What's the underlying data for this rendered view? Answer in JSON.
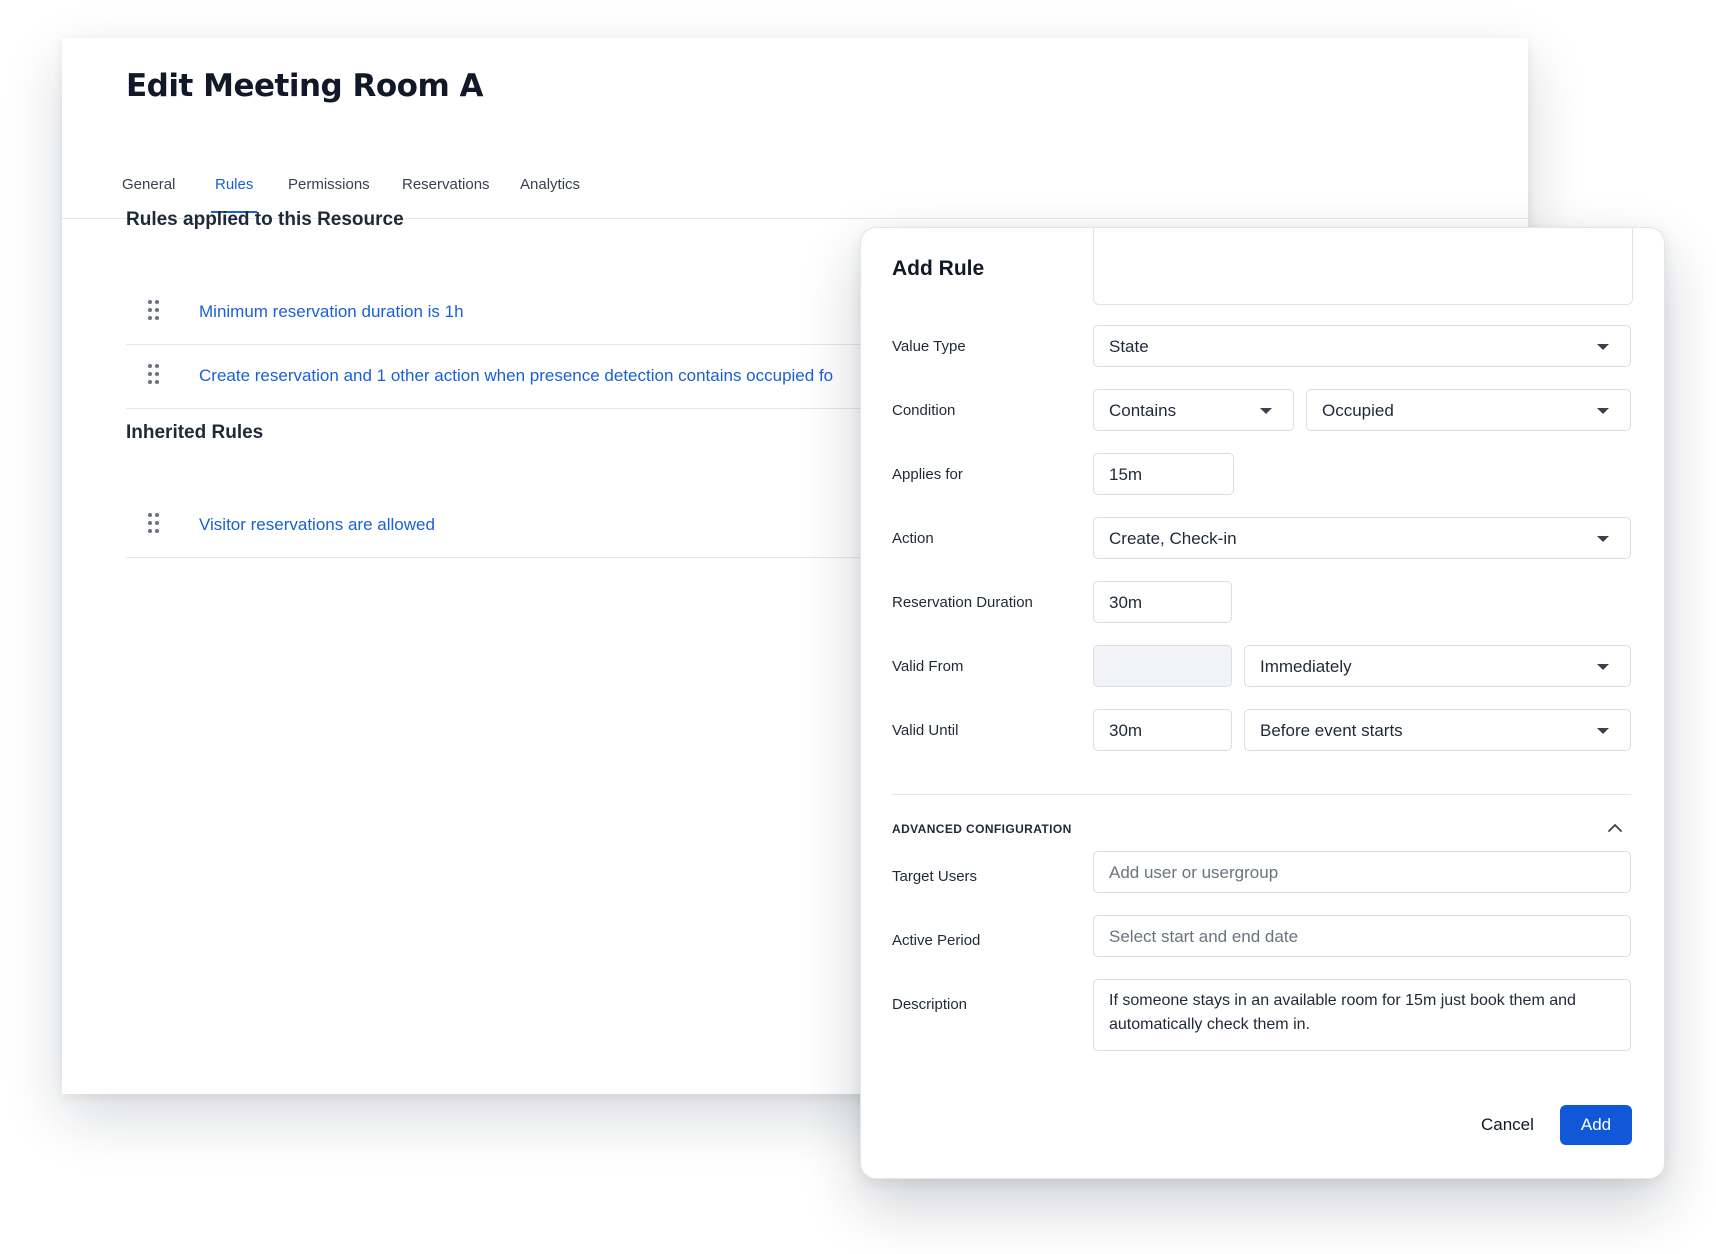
{
  "page": {
    "title": "Edit Meeting Room A",
    "tabs": [
      "General",
      "Rules",
      "Permissions",
      "Reservations",
      "Analytics"
    ],
    "active_tab": "Rules",
    "applied_section_title": "Rules applied to this Resource",
    "applied_rules": [
      "Minimum reservation duration is 1h",
      "Create reservation and 1 other action when presence detection contains occupied  fo"
    ],
    "inherited_section_title": "Inherited Rules",
    "inherited_rules": [
      "Visitor reservations are allowed"
    ]
  },
  "modal": {
    "title": "Add Rule",
    "value_type": {
      "label": "Value Type",
      "value": "State"
    },
    "condition": {
      "label": "Condition",
      "operator": "Contains",
      "value": "Occupied"
    },
    "applies_for": {
      "label": "Applies for",
      "value": "15m"
    },
    "action": {
      "label": "Action",
      "value": "Create, Check-in"
    },
    "reservation_duration": {
      "label": "Reservation Duration",
      "value": "30m"
    },
    "valid_from": {
      "label": "Valid From",
      "value": "",
      "mode": "Immediately"
    },
    "valid_until": {
      "label": "Valid Until",
      "value": "30m",
      "mode": "Before event starts"
    },
    "advanced": {
      "title": "ADVANCED CONFIGURATION",
      "target_users": {
        "label": "Target Users",
        "placeholder": "Add user or usergroup"
      },
      "active_period": {
        "label": "Active Period",
        "placeholder": "Select start and end date"
      },
      "description": {
        "label": "Description",
        "value": "If someone stays in an available room for 15m just book them and automatically check them in."
      }
    },
    "cancel_label": "Cancel",
    "add_label": "Add"
  },
  "colors": {
    "accent": "#1158d9",
    "link": "#1a5fd8",
    "text": "#1f2937",
    "border": "#d9dde3"
  }
}
